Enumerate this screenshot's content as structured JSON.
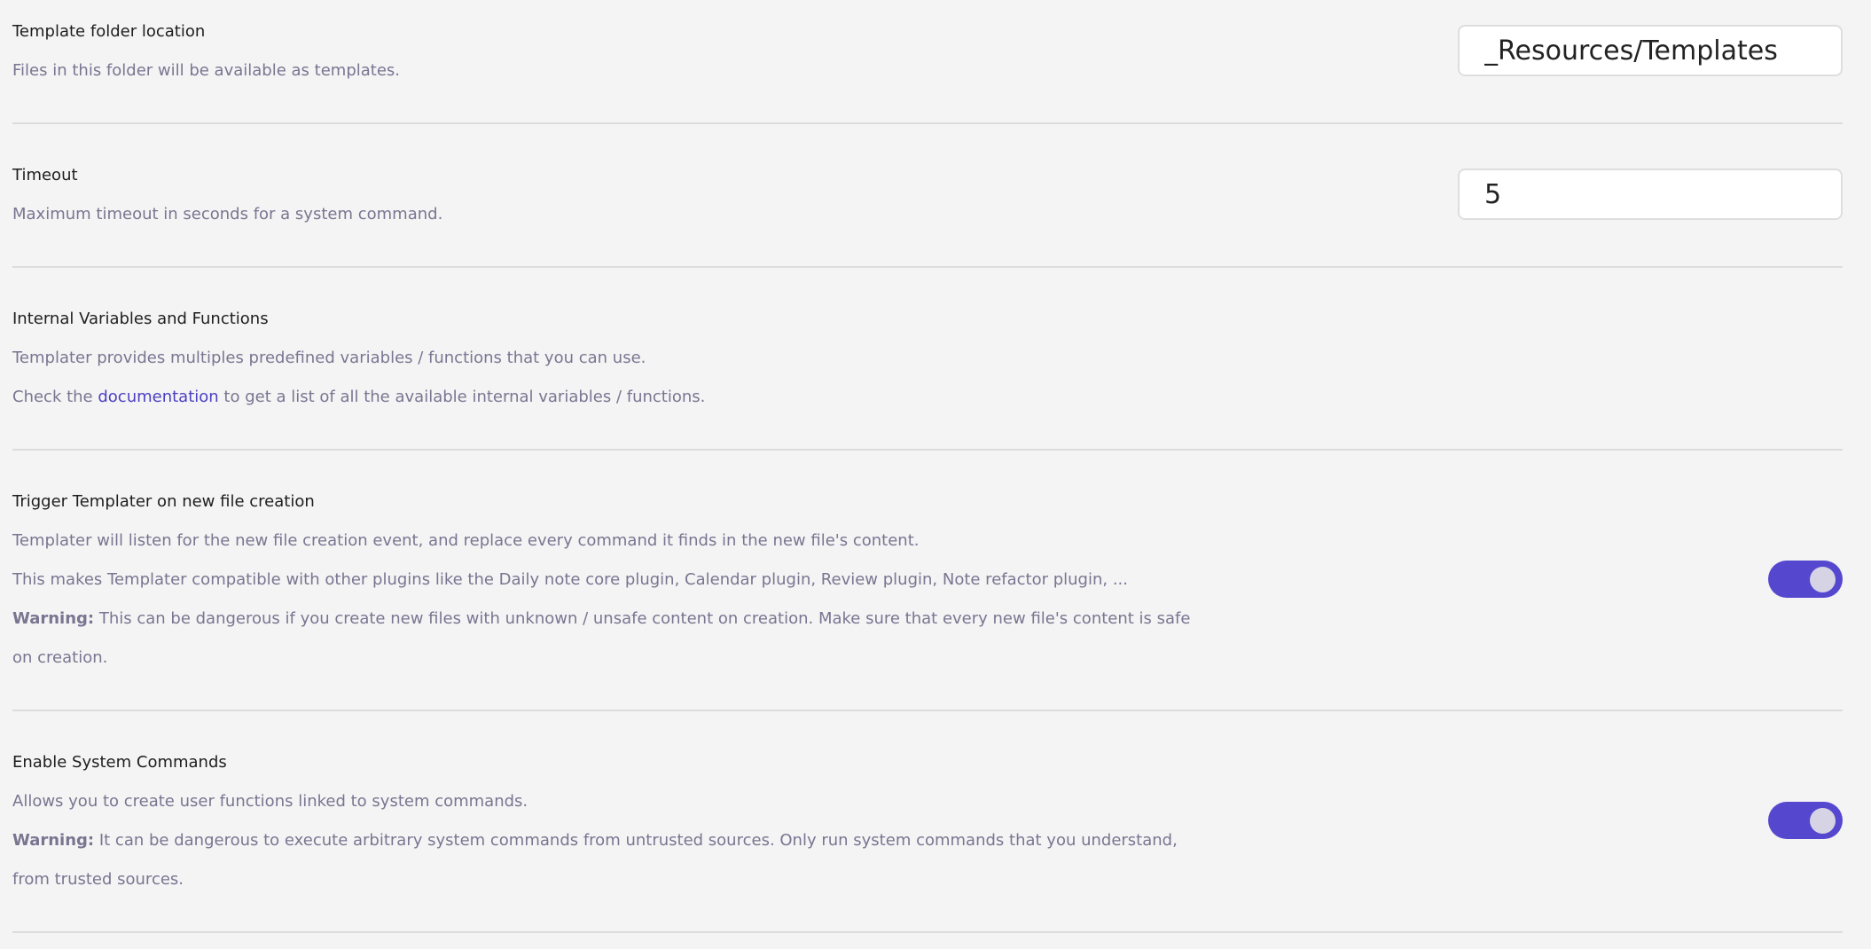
{
  "settings": {
    "template_folder": {
      "name": "Template folder location",
      "desc": "Files in this folder will be available as templates.",
      "value": "_Resources/Templates"
    },
    "timeout": {
      "name": "Timeout",
      "desc": "Maximum timeout in seconds for a system command.",
      "value": "5"
    },
    "internal_vars": {
      "name": "Internal Variables and Functions",
      "desc_line1": "Templater provides multiples predefined variables / functions that you can use.",
      "desc_line2_prefix": "Check the ",
      "desc_line2_link": "documentation",
      "desc_line2_suffix": " to get a list of all the available internal variables / functions."
    },
    "trigger_on_new_file": {
      "name": "Trigger Templater on new file creation",
      "desc_line1": "Templater will listen for the new file creation event, and replace every command it finds in the new file's content.",
      "desc_line2": "This makes Templater compatible with other plugins like the Daily note core plugin, Calendar plugin, Review plugin, Note refactor plugin, ...",
      "warning_label": "Warning:",
      "warning_line1": " This can be dangerous if you create new files with unknown / unsafe content on creation. Make sure that every new file's content is safe",
      "warning_line2": "on creation.",
      "enabled": true
    },
    "system_commands": {
      "name": "Enable System Commands",
      "desc_line1": "Allows you to create user functions linked to system commands.",
      "warning_label": "Warning:",
      "warning_line1": " It can be dangerous to execute arbitrary system commands from untrusted sources. Only run system commands that you understand,",
      "warning_line2": "from trusted sources.",
      "enabled": true
    }
  },
  "colors": {
    "background": "#f4f4f4",
    "accent": "#5548cf",
    "link": "#4b3fc2",
    "description": "#7a7591",
    "divider": "#dcdcdc"
  }
}
